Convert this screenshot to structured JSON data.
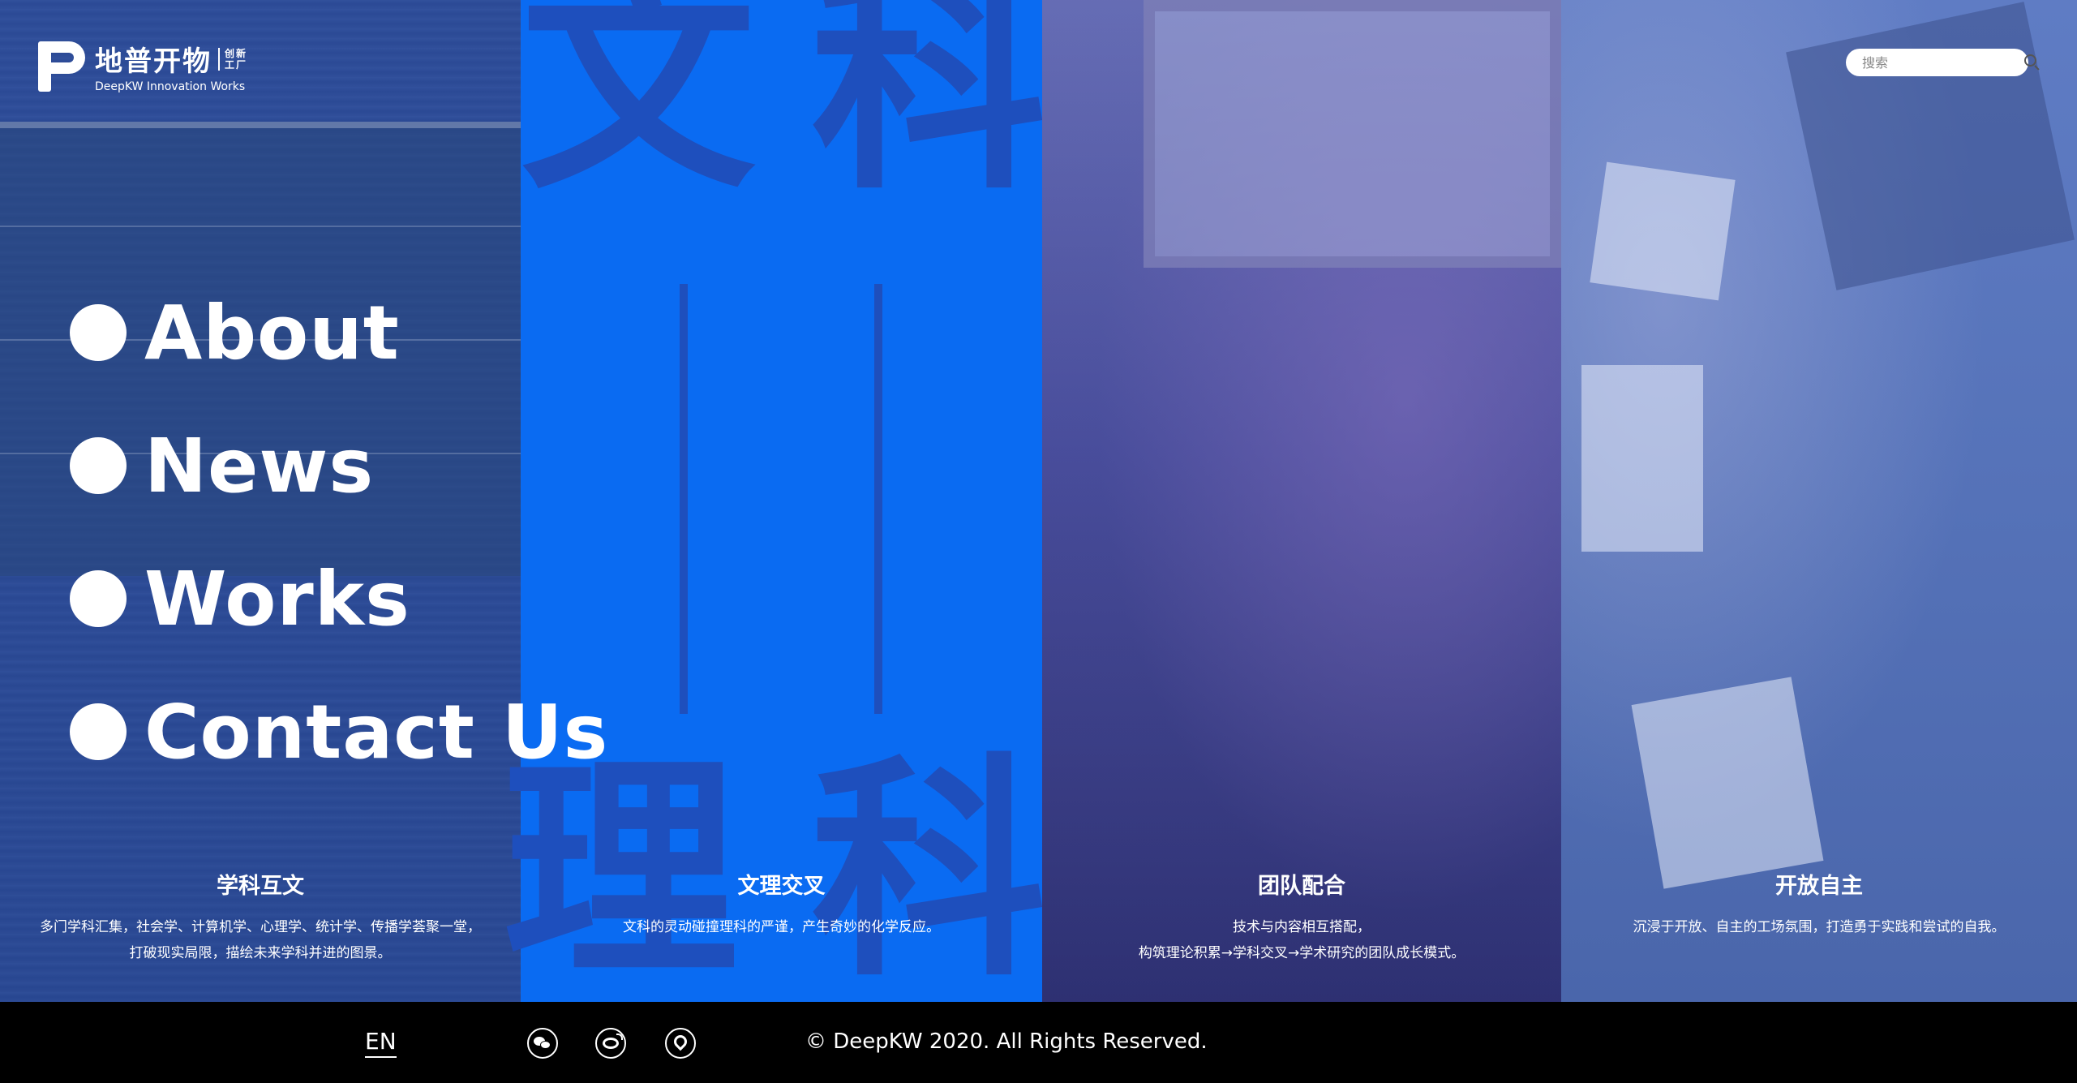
{
  "logo": {
    "cn": "地普开物",
    "cn_small_1": "创新",
    "cn_small_2": "工厂",
    "en": "DeepKW Innovation Works"
  },
  "search": {
    "placeholder": "搜索"
  },
  "nav": [
    {
      "label": "About"
    },
    {
      "label": "News"
    },
    {
      "label": "Works"
    },
    {
      "label": "Contact Us"
    }
  ],
  "decor": {
    "char_1": "文",
    "char_2": "科",
    "char_3": "理",
    "char_4": "科"
  },
  "panels": [
    {
      "title": "学科互文",
      "line1": "多门学科汇集，社会学、计算机学、心理学、统计学、传播学荟聚一堂，",
      "line2": "打破现实局限，描绘未来学科并进的图景。"
    },
    {
      "title": "文理交叉",
      "line1": "文科的灵动碰撞理科的严谨，产生奇妙的化学反应。",
      "line2": ""
    },
    {
      "title": "团队配合",
      "line1": "技术与内容相互搭配，",
      "line2": "构筑理论积累→学科交叉→学术研究的团队成长模式。"
    },
    {
      "title": "开放自主",
      "line1": "沉浸于开放、自主的工场氛围，打造勇于实践和尝试的自我。",
      "line2": ""
    }
  ],
  "footer": {
    "lang": "EN",
    "copyright": "© DeepKW 2020. All Rights Reserved."
  },
  "icons": {
    "social": [
      "wechat-icon",
      "weibo-icon",
      "location-icon"
    ],
    "search": "search-icon"
  },
  "colors": {
    "accent_blue": "#0a6bf2",
    "char_blue": "#1e4fbd",
    "footer_bg": "#000000"
  }
}
